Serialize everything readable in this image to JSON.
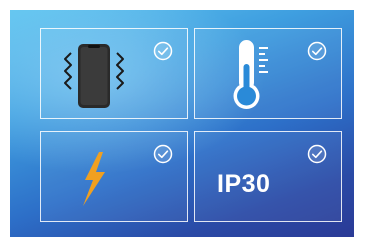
{
  "features": [
    {
      "name": "vibration",
      "icon": "vibrating-phone-icon",
      "checked": true
    },
    {
      "name": "temperature",
      "icon": "thermometer-icon",
      "checked": true
    },
    {
      "name": "power",
      "icon": "lightning-bolt-icon",
      "checked": true
    },
    {
      "name": "ip-rating",
      "label": "IP30",
      "checked": true
    }
  ],
  "colors": {
    "background_top": "#62c6f0",
    "background_bottom": "#2a3a96",
    "tile_border": "#ffffff",
    "check": "#ffffff",
    "bolt": "#f0a020",
    "thermo_bulb": "#2a8ad8"
  }
}
